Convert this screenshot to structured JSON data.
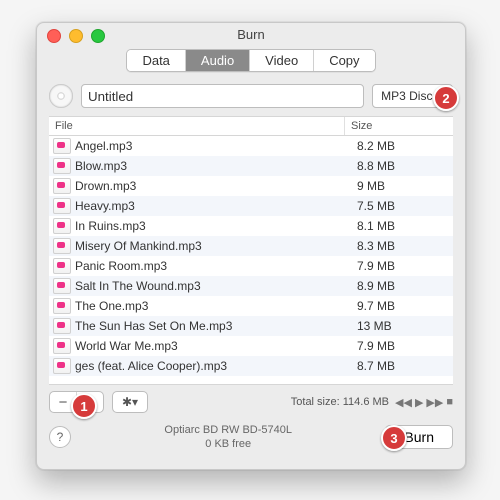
{
  "window": {
    "title": "Burn"
  },
  "tabs": {
    "data": "Data",
    "audio": "Audio",
    "video": "Video",
    "copy": "Copy",
    "active": "audio"
  },
  "disc": {
    "name_value": "Untitled",
    "name_placeholder": "Untitled",
    "type_label": "MP3 Disc"
  },
  "columns": {
    "file": "File",
    "size": "Size"
  },
  "files": [
    {
      "name": "Angel.mp3",
      "size": "8.2 MB"
    },
    {
      "name": "Blow.mp3",
      "size": "8.8 MB"
    },
    {
      "name": "Drown.mp3",
      "size": "9 MB"
    },
    {
      "name": "Heavy.mp3",
      "size": "7.5 MB"
    },
    {
      "name": "In Ruins.mp3",
      "size": "8.1 MB"
    },
    {
      "name": "Misery Of Mankind.mp3",
      "size": "8.3 MB"
    },
    {
      "name": "Panic Room.mp3",
      "size": "7.9 MB"
    },
    {
      "name": "Salt In The Wound.mp3",
      "size": "8.9 MB"
    },
    {
      "name": "The One.mp3",
      "size": "9.7 MB"
    },
    {
      "name": "The Sun Has Set On Me.mp3",
      "size": "13 MB"
    },
    {
      "name": "World War Me.mp3",
      "size": "7.9 MB"
    },
    {
      "name": "ges (feat. Alice Cooper).mp3",
      "size": "8.7 MB"
    }
  ],
  "footer": {
    "total_label": "Total size:",
    "total_value": "114.6 MB",
    "drive": "Optiarc BD RW BD-5740L",
    "free": "0 KB free",
    "burn": "Burn"
  },
  "glyphs": {
    "remove": "−",
    "add": "+",
    "gear": "✱▾",
    "help": "?",
    "prev": "◀◀",
    "play": "▶",
    "next": "▶▶",
    "stop": "■",
    "chev": "⌄"
  },
  "annotations": {
    "b1": "1",
    "b2": "2",
    "b3": "3"
  }
}
